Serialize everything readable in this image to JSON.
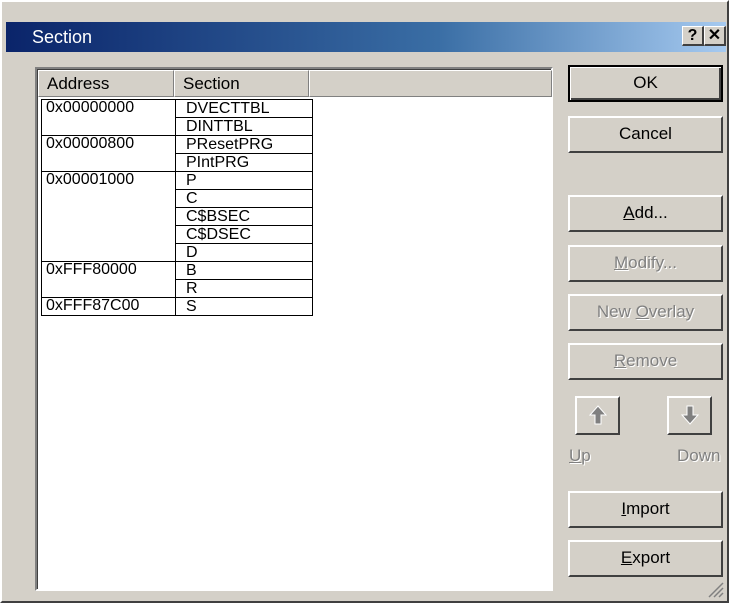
{
  "window": {
    "title": "Section",
    "help_label": "?",
    "close_label": "✕"
  },
  "list": {
    "headers": {
      "address": "Address",
      "section": "Section"
    },
    "rows": [
      {
        "address": "0x00000000",
        "sections": [
          "DVECTTBL",
          "DINTTBL"
        ]
      },
      {
        "address": "0x00000800",
        "sections": [
          "PResetPRG",
          "PIntPRG"
        ]
      },
      {
        "address": "0x00001000",
        "sections": [
          "P",
          "C",
          "C$BSEC",
          "C$DSEC",
          "D"
        ]
      },
      {
        "address": "0xFFF80000",
        "sections": [
          "B",
          "R"
        ]
      },
      {
        "address": "0xFFF87C00",
        "sections": [
          "S"
        ]
      }
    ]
  },
  "buttons": {
    "ok": "OK",
    "cancel": "Cancel",
    "add": {
      "mnemonic": "A",
      "rest": "dd..."
    },
    "modify": {
      "mnemonic": "M",
      "rest": "odify..."
    },
    "new_overlay": {
      "prefix": "New ",
      "mnemonic": "O",
      "rest": "verlay"
    },
    "remove": {
      "mnemonic": "R",
      "rest": "emove"
    },
    "up": {
      "mnemonic": "U",
      "rest": "p"
    },
    "down": "Down",
    "import": {
      "mnemonic": "I",
      "rest": "mport"
    },
    "export": {
      "mnemonic": "E",
      "rest": "xport"
    }
  },
  "icons": {
    "up": "up-arrow-icon",
    "down": "down-arrow-icon",
    "resize": "size-grip-icon"
  },
  "colors": {
    "title_start": "#0a246a",
    "title_end": "#a6caf0",
    "face": "#d4d0c8",
    "disabled_text": "#808080"
  }
}
